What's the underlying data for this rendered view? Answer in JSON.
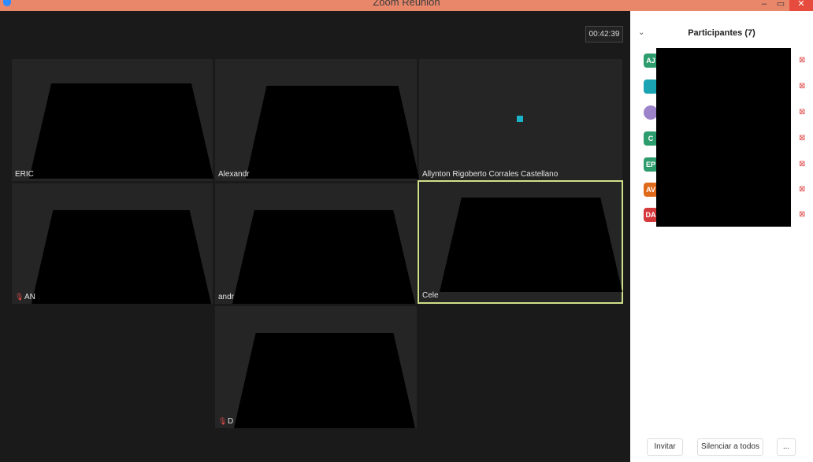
{
  "window": {
    "title": "Zoom Reunión"
  },
  "timer": "00:42:39",
  "tiles": [
    {
      "name": "ERIC"
    },
    {
      "name": "Alexandr"
    },
    {
      "name": "Allynton Rigoberto Corrales Castellano"
    },
    {
      "name": "AN"
    },
    {
      "name": "andr"
    },
    {
      "name": "Cele"
    },
    {
      "name": "D"
    }
  ],
  "panel": {
    "title": "Participantes (7)",
    "participants": [
      {
        "initials": "AJ",
        "color": "#2e9d6e"
      },
      {
        "initials": "",
        "color": "#1aa3b3"
      },
      {
        "initials": "",
        "color": "#9d83c9"
      },
      {
        "initials": "C",
        "color": "#2e9d6e"
      },
      {
        "initials": "EP",
        "color": "#2e9d6e"
      },
      {
        "initials": "AV",
        "color": "#e06a1b"
      },
      {
        "initials": "DA",
        "color": "#d4383b"
      }
    ],
    "invite_label": "Invitar",
    "mute_all_label": "Silenciar a todos",
    "more_label": "..."
  }
}
